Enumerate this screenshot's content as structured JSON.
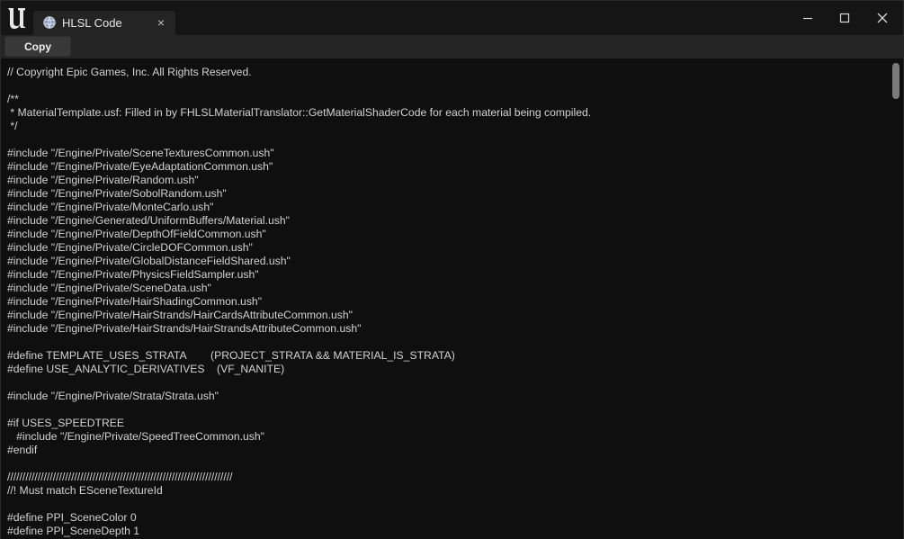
{
  "window": {
    "tab_title": "HLSL Code",
    "tab_close_glyph": "×",
    "tab_icon": "material-sphere-icon",
    "logo_icon": "unreal-engine-logo-icon"
  },
  "toolbar": {
    "copy_label": "Copy"
  },
  "colors": {
    "background": "#151515",
    "code_background": "#0f0f0f",
    "text": "#d2d2d2",
    "tab": "#242424"
  },
  "code_lines": [
    "// Copyright Epic Games, Inc. All Rights Reserved.",
    "",
    "/**",
    " * MaterialTemplate.usf: Filled in by FHLSLMaterialTranslator::GetMaterialShaderCode for each material being compiled.",
    " */",
    "",
    "#include \"/Engine/Private/SceneTexturesCommon.ush\"",
    "#include \"/Engine/Private/EyeAdaptationCommon.ush\"",
    "#include \"/Engine/Private/Random.ush\"",
    "#include \"/Engine/Private/SobolRandom.ush\"",
    "#include \"/Engine/Private/MonteCarlo.ush\"",
    "#include \"/Engine/Generated/UniformBuffers/Material.ush\"",
    "#include \"/Engine/Private/DepthOfFieldCommon.ush\"",
    "#include \"/Engine/Private/CircleDOFCommon.ush\"",
    "#include \"/Engine/Private/GlobalDistanceFieldShared.ush\"",
    "#include \"/Engine/Private/PhysicsFieldSampler.ush\"",
    "#include \"/Engine/Private/SceneData.ush\"",
    "#include \"/Engine/Private/HairShadingCommon.ush\"",
    "#include \"/Engine/Private/HairStrands/HairCardsAttributeCommon.ush\"",
    "#include \"/Engine/Private/HairStrands/HairStrandsAttributeCommon.ush\"",
    "",
    "#define TEMPLATE_USES_STRATA        (PROJECT_STRATA && MATERIAL_IS_STRATA)",
    "#define USE_ANALYTIC_DERIVATIVES    (VF_NANITE)",
    "",
    "#include \"/Engine/Private/Strata/Strata.ush\"",
    "",
    "#if USES_SPEEDTREE",
    "   #include \"/Engine/Private/SpeedTreeCommon.ush\"",
    "#endif",
    "",
    "//////////////////////////////////////////////////////////////////////////",
    "//! Must match ESceneTextureId",
    "",
    "#define PPI_SceneColor 0",
    "#define PPI_SceneDepth 1"
  ]
}
